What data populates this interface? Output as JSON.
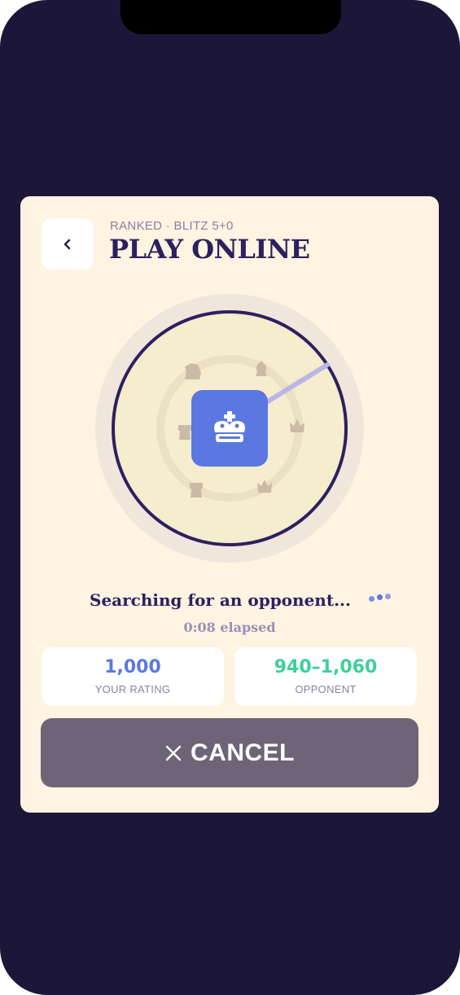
{
  "header": {
    "subtitle": "RANKED · BLITZ 5+0",
    "title": "PLAY ONLINE"
  },
  "search": {
    "status": "Searching for an opponent...",
    "elapsed": "0:08 elapsed"
  },
  "stats": {
    "your_rating_value": "1,000",
    "your_rating_label": "YOUR RATING",
    "opponent_value": "940–1,060",
    "opponent_label": "OPPONENT"
  },
  "cancel": {
    "label": "CANCEL",
    "icon": "close-icon"
  },
  "icons": {
    "back": "chevron-left-icon",
    "center": "king-icon",
    "orbit": [
      "knight-icon",
      "bishop-icon",
      "queen-icon",
      "rook-icon",
      "queen-icon",
      "rook-icon",
      "knight-icon"
    ]
  },
  "colors": {
    "background": "#1c1639",
    "card": "#fff3e1",
    "accent_blue": "#5b78e0",
    "rating_blue": "#5b78e0",
    "opponent_green": "#3ecf9a",
    "cancel_bg": "#6d6577",
    "title": "#2b2160"
  }
}
